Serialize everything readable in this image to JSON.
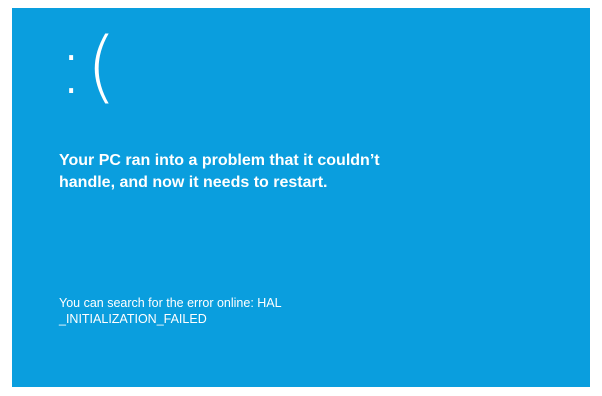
{
  "screen": {
    "background_color": "#0a9ede",
    "text_color": "#ffffff",
    "sad_face": ":(",
    "headline_line1": "Your PC ran into a problem that it couldn’t",
    "headline_line2": "handle, and now it needs to restart.",
    "info_line1": "You can search for the error online: HAL",
    "info_line2": "_INITIALIZATION_FAILED"
  }
}
